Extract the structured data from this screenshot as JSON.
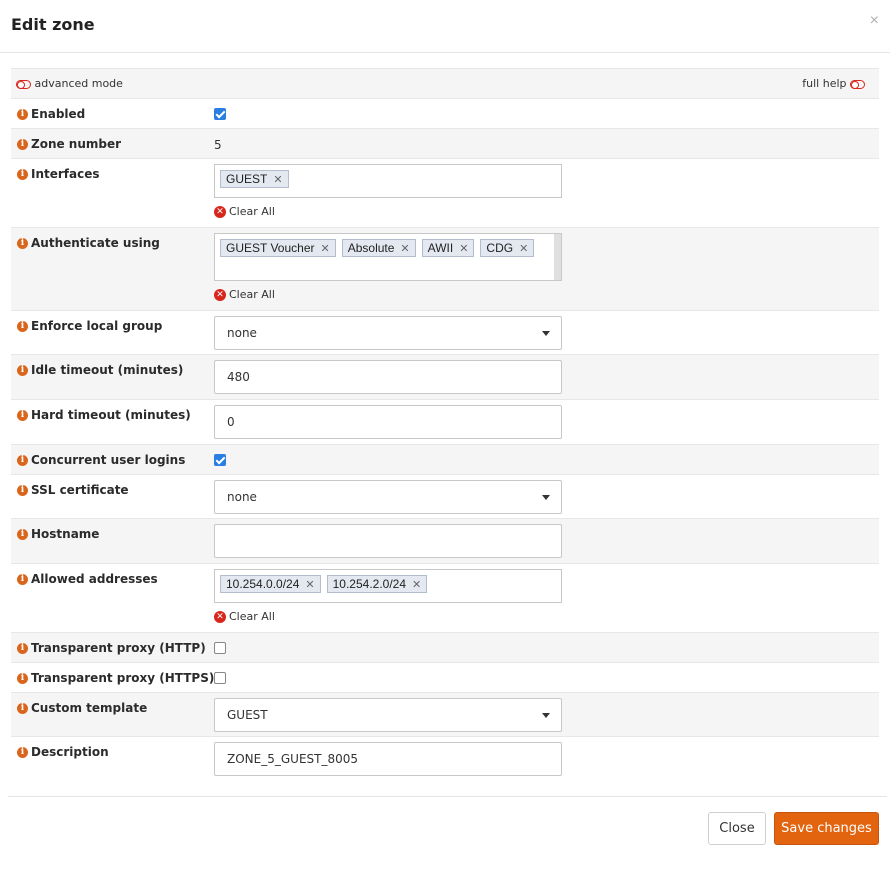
{
  "modal": {
    "title": "Edit zone",
    "close_symbol": "×"
  },
  "modes": {
    "advanced_label": "advanced mode",
    "help_label": "full help"
  },
  "fields": {
    "enabled": {
      "label": "Enabled",
      "checked": true
    },
    "zone_number": {
      "label": "Zone number",
      "value": "5"
    },
    "interfaces": {
      "label": "Interfaces",
      "tags": [
        "GUEST"
      ],
      "clear_label": "Clear All"
    },
    "authenticate": {
      "label": "Authenticate using",
      "tags": [
        "GUEST Voucher",
        "Absolute",
        "AWII",
        "CDG"
      ],
      "clear_label": "Clear All"
    },
    "local_group": {
      "label": "Enforce local group",
      "value": "none"
    },
    "idle_timeout": {
      "label": "Idle timeout (minutes)",
      "value": "480"
    },
    "hard_timeout": {
      "label": "Hard timeout (minutes)",
      "value": "0"
    },
    "concurrent": {
      "label": "Concurrent user logins",
      "checked": true
    },
    "ssl_cert": {
      "label": "SSL certificate",
      "value": "none"
    },
    "hostname": {
      "label": "Hostname",
      "value": ""
    },
    "allowed": {
      "label": "Allowed addresses",
      "tags": [
        "10.254.0.0/24",
        "10.254.2.0/24"
      ],
      "clear_label": "Clear All"
    },
    "proxy_http": {
      "label": "Transparent proxy (HTTP)",
      "checked": false
    },
    "proxy_https": {
      "label": "Transparent proxy (HTTPS)",
      "checked": false
    },
    "template": {
      "label": "Custom template",
      "value": "GUEST"
    },
    "description": {
      "label": "Description",
      "value": "ZONE_5_GUEST_8005"
    }
  },
  "footer": {
    "close_label": "Close",
    "save_label": "Save changes"
  },
  "icons": {
    "info": "info-icon",
    "clear": "clear-icon",
    "toggle": "toggle-off-icon"
  },
  "colors": {
    "accent": "#e2640f",
    "info_icon": "#d9661c",
    "clear_icon": "#d9261c",
    "checkbox": "#2a7de1"
  }
}
